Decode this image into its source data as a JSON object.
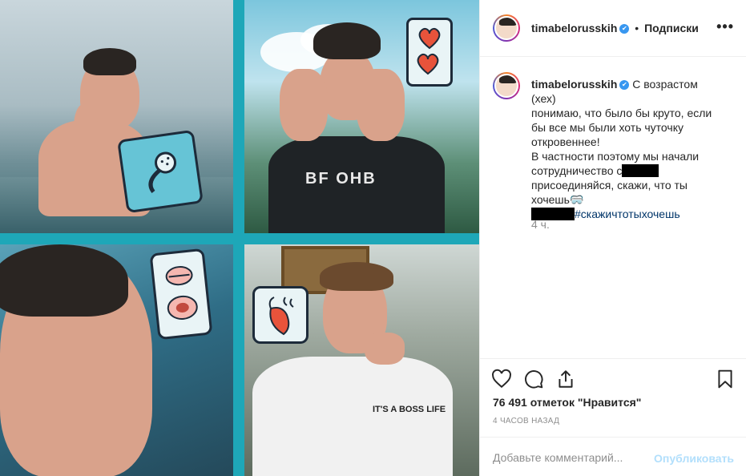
{
  "post": {
    "author": "timabelorusskih",
    "follow_separator": "•",
    "follow_label": "Подписки",
    "more_label": "•••",
    "caption": {
      "author": "timabelorusskih",
      "line1": "С возрастом (хех)",
      "line2": "понимаю, что было бы круто, если",
      "line3": "бы все мы были хоть чуточку",
      "line4": "откровеннее!",
      "line5": "В частности поэтому мы начали",
      "line6": "сотрудничество с",
      "line7": "присоединяйся, скажи, что ты",
      "line8": "хочешь",
      "line8_emoji": "🥽",
      "hashtag": "#скажичтотыхочешь"
    },
    "caption_time": "4 ч.",
    "likes": "76 491 отметок \"Нравится\"",
    "posted_ago": "4 часов назад",
    "comment": {
      "placeholder": "Добавьте комментарий...",
      "publish_label": "Опубликовать"
    },
    "shirt_text_1": "BF OHB",
    "shirt_text_2": "IT'S A BOSS LIFE"
  },
  "colors": {
    "collage_bg": "#1ea7b8",
    "verified": "#3897f0",
    "publish_disabled": "#b2dffc",
    "heart_sticker": "#e8533b"
  },
  "icons": {
    "like": "heart-icon",
    "comment": "comment-icon",
    "share": "share-icon",
    "save": "bookmark-icon",
    "more": "more-icon",
    "verified": "verified-badge-icon"
  }
}
